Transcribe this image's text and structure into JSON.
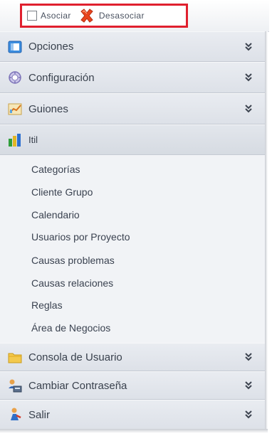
{
  "toolbar": {
    "associate_label": "Asociar",
    "dissociate_label": "Desasociar"
  },
  "sections": [
    {
      "label": "Opciones",
      "icon": "window-icon",
      "expanded": false
    },
    {
      "label": "Configuración",
      "icon": "settings-globe-icon",
      "expanded": false
    },
    {
      "label": "Guiones",
      "icon": "chart-icon",
      "expanded": false
    },
    {
      "label": "Itil",
      "icon": "bar-chart-icon",
      "expanded": true
    },
    {
      "label": "Consola de Usuario",
      "icon": "folder-icon",
      "expanded": false
    },
    {
      "label": "Cambiar Contraseña",
      "icon": "users-password-icon",
      "expanded": false
    },
    {
      "label": "Salir",
      "icon": "exit-person-icon",
      "expanded": false
    }
  ],
  "itil_items": [
    "Categorías",
    "Cliente Grupo",
    "Calendario",
    "Usuarios por Proyecto",
    "Causas problemas",
    "Causas relaciones",
    "Reglas",
    "Área de Negocios"
  ],
  "colors": {
    "highlight_border": "#e0202e",
    "section_bg": "#e3e7ec",
    "subitem_bg": "#f1f3f6",
    "text": "#39414d"
  }
}
